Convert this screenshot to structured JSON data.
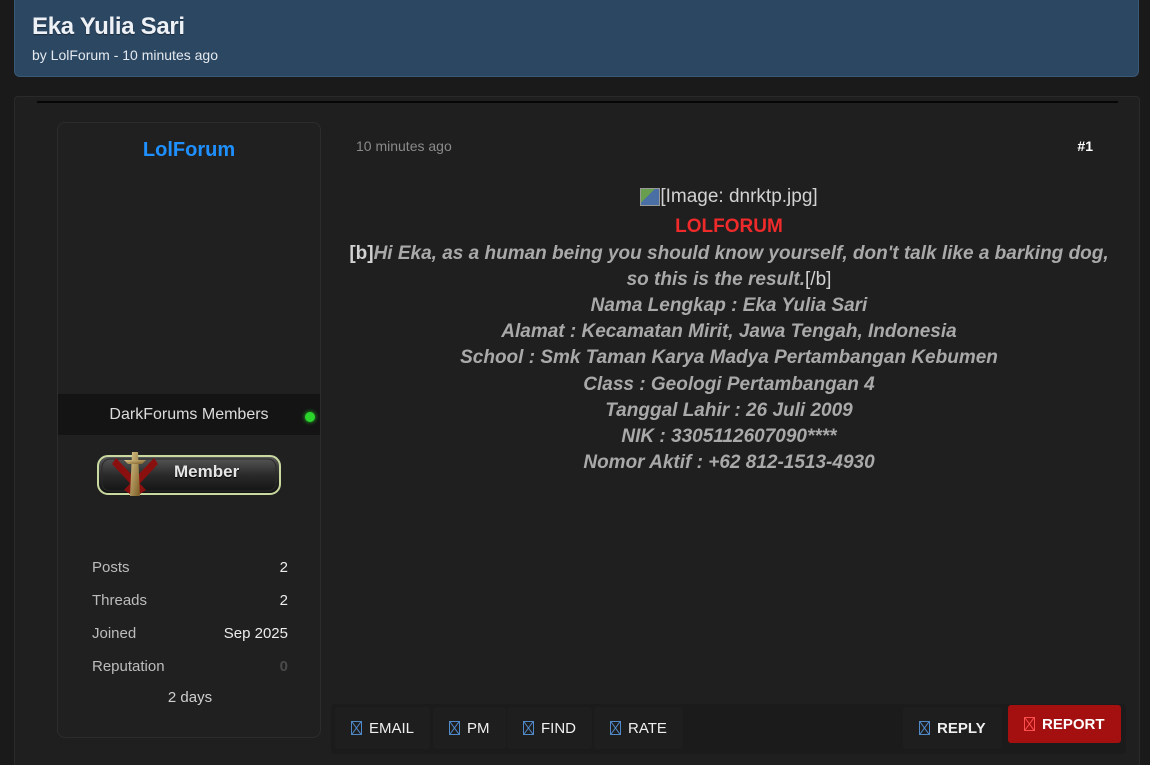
{
  "thread": {
    "title": "Eka Yulia Sari",
    "meta": "by LolForum - 10 minutes ago"
  },
  "author": {
    "name": "LolForum",
    "group": "DarkForums Members",
    "online": true,
    "rank_label": "Member",
    "stats": [
      {
        "label": "Posts",
        "value": "2"
      },
      {
        "label": "Threads",
        "value": "2"
      },
      {
        "label": "Joined",
        "value": "Sep 2025"
      },
      {
        "label": "Reputation",
        "value": "0"
      }
    ],
    "extra": "2 days"
  },
  "post": {
    "time": "10 minutes ago",
    "number": "#1",
    "image_alt": "[Image: dnrktp.jpg]",
    "brand": "LOLFORUM",
    "bb_open": "[b]",
    "message": "Hi Eka, as a human being you should know yourself, don't talk like a barking dog, so this is the result.",
    "bb_close": "[/b]",
    "lines": [
      "Nama Lengkap : Eka Yulia Sari",
      "Alamat : Kecamatan Mirit, Jawa Tengah, Indonesia",
      "School : Smk Taman Karya Madya Pertambangan Kebumen",
      "Class : Geologi Pertambangan 4",
      "Tanggal Lahir : 26 Juli 2009",
      "NIK : 3305112607090****",
      "Nomor Aktif : +62 812-1513-4930"
    ]
  },
  "actions": {
    "email": "EMAIL",
    "pm": "PM",
    "find": "FIND",
    "rate": "RATE",
    "reply": "REPLY",
    "report": "REPORT"
  },
  "colors": {
    "header_bg": "#2c4762",
    "username": "#1e90ff",
    "brand": "#ee2a2a",
    "report_bg": "#a41010",
    "online": "#2bd42b"
  }
}
